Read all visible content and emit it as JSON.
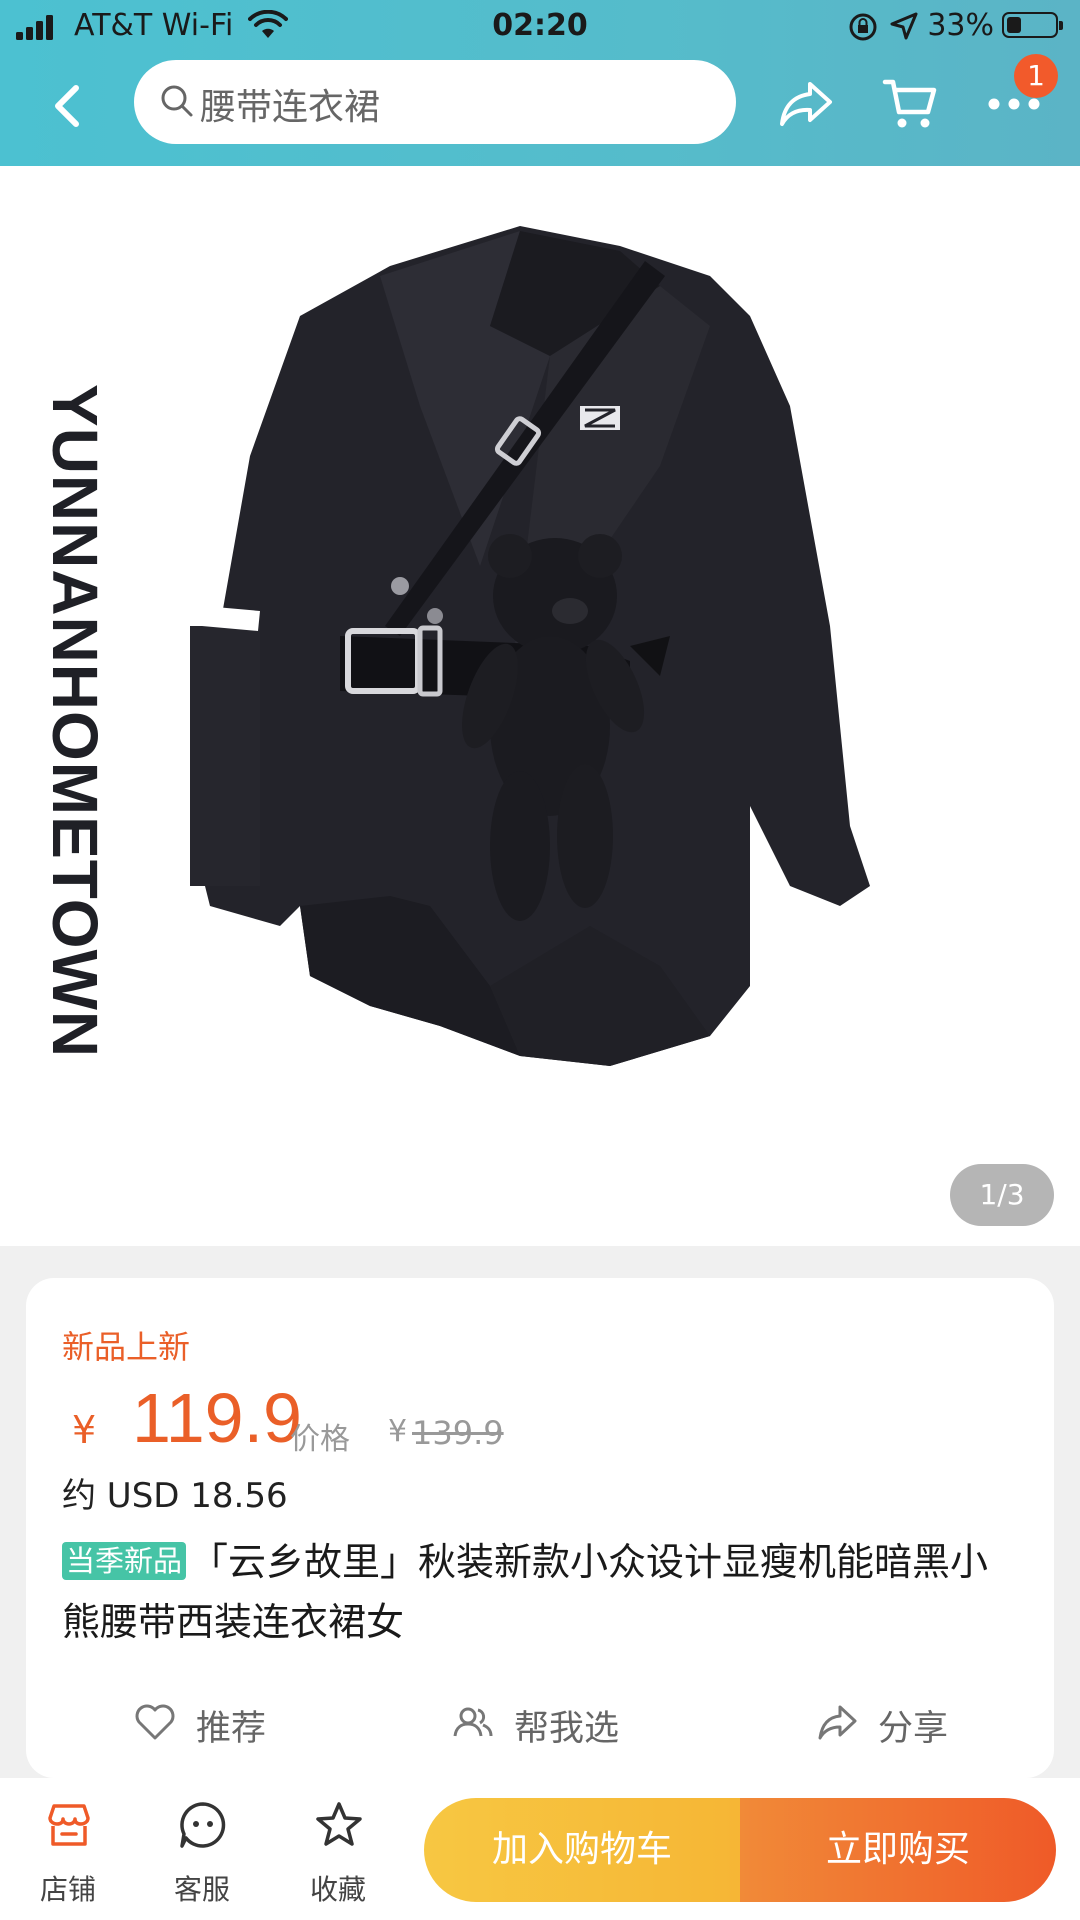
{
  "status_bar": {
    "carrier": "AT&T Wi-Fi",
    "time": "02:20",
    "battery": "33%"
  },
  "nav": {
    "search_text": "腰带连衣裙",
    "cart_badge": "1",
    "icons": [
      "back-icon",
      "search-icon",
      "share-icon",
      "cart-icon",
      "more-icon"
    ]
  },
  "gallery": {
    "brand": "YUNNANHOMETOWN",
    "page_indicator": "1/3"
  },
  "product": {
    "tag": "新品上新",
    "currency": "¥",
    "price": "119.9",
    "orig_label": "价格",
    "orig_currency": "¥",
    "orig_price": "139.9",
    "usd": "约 USD 18.56",
    "season_tag": "当季新品",
    "title": "「云乡故里」秋装新款小众设计显瘦机能暗黑小熊腰带西装连衣裙女"
  },
  "actions": {
    "recommend": "推荐",
    "help_choose": "帮我选",
    "share": "分享"
  },
  "bottom_bar": {
    "store": "店铺",
    "service": "客服",
    "favorite": "收藏",
    "add_cart": "加入购物车",
    "buy_now": "立即购买"
  },
  "colors": {
    "header": "#4cc1d1",
    "accent": "#ea5f28",
    "tag_green": "#46c4a6",
    "cart_yellow": "#f7c742",
    "buy_orange": "#ef5a28"
  }
}
